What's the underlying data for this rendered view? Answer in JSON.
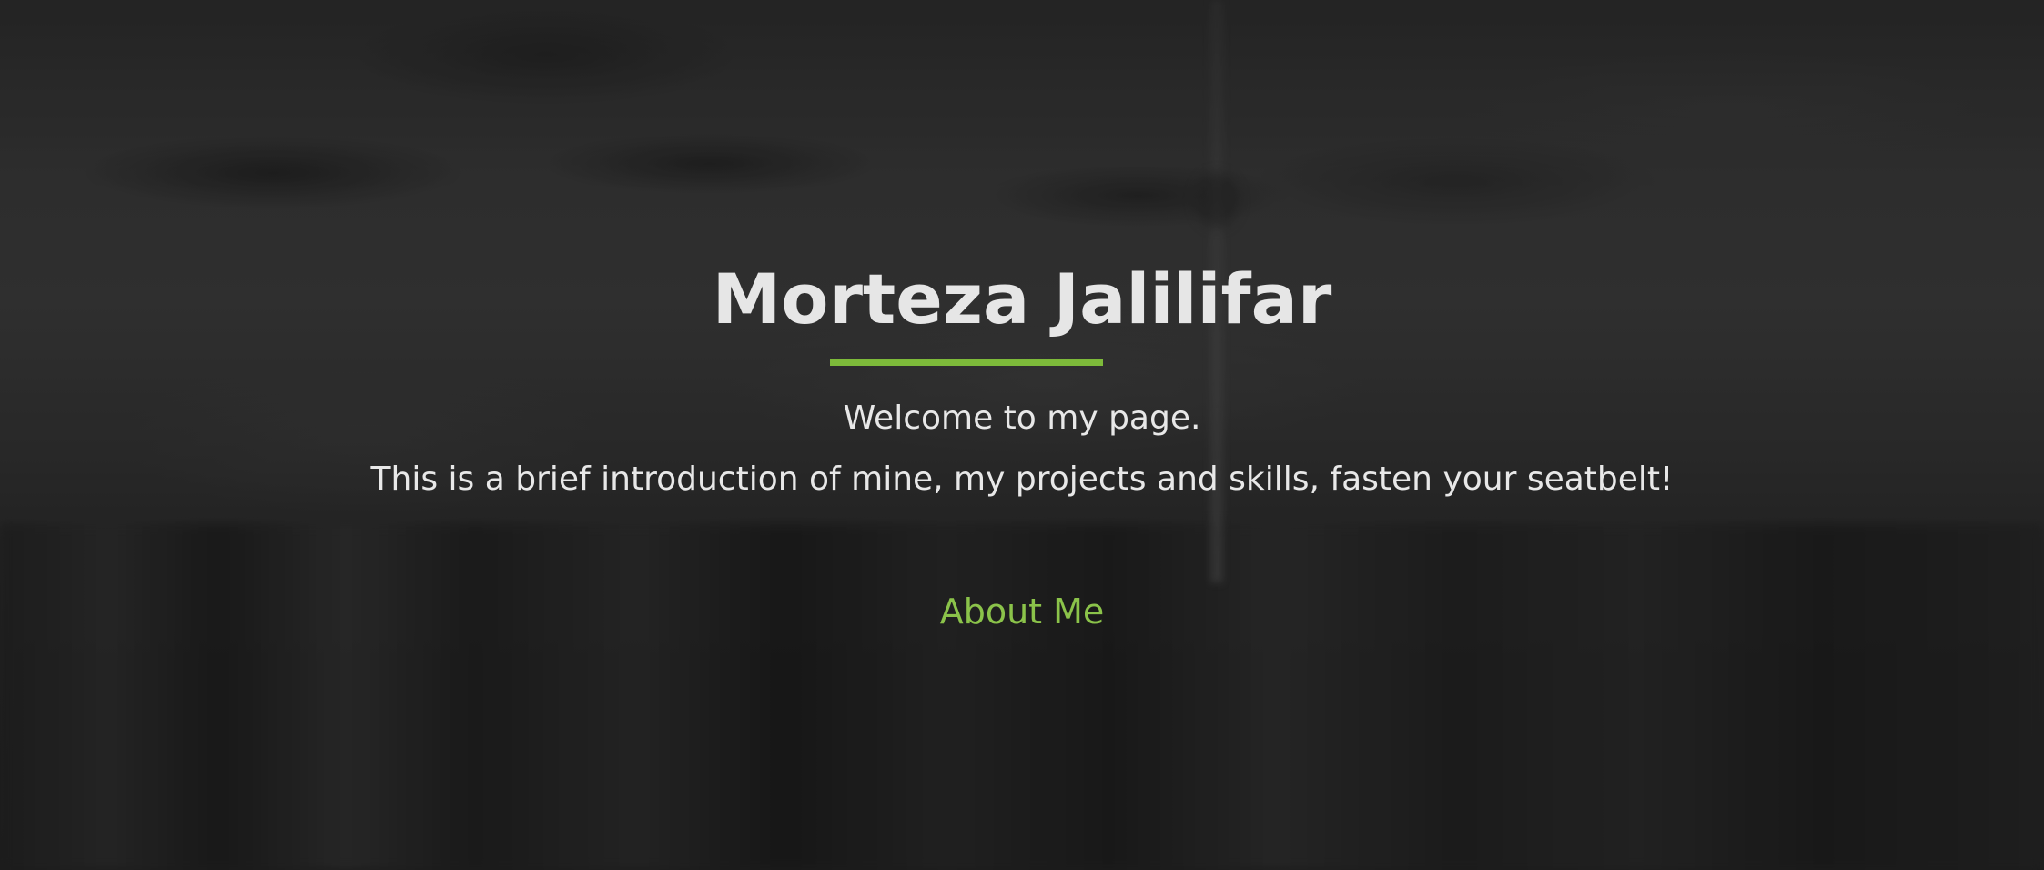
{
  "hero": {
    "title": "Morteza Jalilifar",
    "welcome": "Welcome to my page.",
    "intro": "This is a brief introduction of mine, my projects and skills, fasten your seatbelt!",
    "about_link": "About Me"
  },
  "colors": {
    "accent": "#7dba3a",
    "link": "#8bc34a",
    "text": "#e8e8e8",
    "background": "#2b2b2b"
  }
}
